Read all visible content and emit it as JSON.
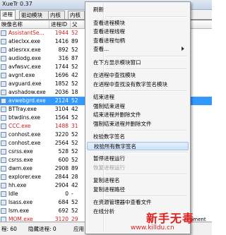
{
  "window": {
    "title": "XueTr 0.37"
  },
  "tabs": [
    {
      "label": "进程",
      "active": true
    },
    {
      "label": "驱动模块",
      "active": false
    },
    {
      "label": "内核",
      "active": false
    },
    {
      "label": "内核",
      "active": false
    }
  ],
  "columns": {
    "name": "映像名称",
    "pid": "进程ID",
    "ppid": "父"
  },
  "processes": [
    {
      "name": "AssistantSe...",
      "pid": "1944",
      "ppid": "52",
      "color": "red"
    },
    {
      "name": "atieclxx.exe",
      "pid": "1416",
      "ppid": "89",
      "color": "normal"
    },
    {
      "name": "atiesrxx.exe",
      "pid": "892",
      "ppid": "52",
      "color": "normal"
    },
    {
      "name": "audiodg.exe",
      "pid": "316",
      "ppid": "87",
      "color": "normal"
    },
    {
      "name": "avfwsvc.exe",
      "pid": "1744",
      "ppid": "52",
      "color": "normal"
    },
    {
      "name": "avgnt.exe",
      "pid": "1696",
      "ppid": "42",
      "color": "normal"
    },
    {
      "name": "avguard.exe",
      "pid": "1852",
      "ppid": "52",
      "color": "normal"
    },
    {
      "name": "avshadow.exe",
      "pid": "2036",
      "ppid": "18",
      "color": "normal"
    },
    {
      "name": "avwebgrd.exe",
      "pid": "2124",
      "ppid": "52",
      "color": "selected"
    },
    {
      "name": "BTTray.exe",
      "pid": "3104",
      "ppid": "42",
      "color": "normal"
    },
    {
      "name": "btwdins.exe",
      "pid": "1564",
      "ppid": "52",
      "color": "normal"
    },
    {
      "name": "CCC.exe",
      "pid": "1488",
      "ppid": "31",
      "color": "red"
    },
    {
      "name": "conhost.exe",
      "pid": "3220",
      "ppid": "52",
      "color": "normal"
    },
    {
      "name": "conhost.exe",
      "pid": "2564",
      "ppid": "52",
      "color": "normal"
    },
    {
      "name": "csrss.exe",
      "pid": "528",
      "ppid": "52",
      "color": "normal"
    },
    {
      "name": "csrss.exe",
      "pid": "600",
      "ppid": "52",
      "color": "normal"
    },
    {
      "name": "dwm.exe",
      "pid": "2908",
      "ppid": "89",
      "color": "normal"
    },
    {
      "name": "explorer.exe",
      "pid": "2844",
      "ppid": "28",
      "color": "normal"
    },
    {
      "name": "hh.exe",
      "pid": "2904",
      "ppid": "42",
      "color": "normal"
    },
    {
      "name": "Idle",
      "pid": "0",
      "ppid": "-",
      "color": "normal"
    },
    {
      "name": "lsass.exe",
      "pid": "684",
      "ppid": "52",
      "color": "normal"
    },
    {
      "name": "lsm.exe",
      "pid": "692",
      "ppid": "52",
      "color": "normal"
    },
    {
      "name": "MOM.exe",
      "pid": "3120",
      "ppid": "29",
      "color": "red"
    }
  ],
  "right_fragments": [
    "",
    "",
    "",
    "",
    "",
    "",
    "",
    "",
    "",
    "",
    "",
    "",
    "",
    "",
    "",
    "",
    "",
    "",
    "",
    "",
    "",
    "",
    "lement"
  ],
  "status": {
    "count": "程: 60",
    "hidden": "隐藏进程: 0",
    "tail": "应用"
  },
  "menu": {
    "items": [
      {
        "label": "刷新",
        "state": "normal",
        "submenu": false
      },
      {
        "sep": true
      },
      {
        "label": "查看进程模块",
        "state": "normal",
        "submenu": false
      },
      {
        "label": "查看进程线程",
        "state": "normal",
        "submenu": false
      },
      {
        "label": "查看进程句柄",
        "state": "normal",
        "submenu": false
      },
      {
        "label": "查看...",
        "state": "normal",
        "submenu": true
      },
      {
        "sep": true
      },
      {
        "label": "在下方显示模块窗口",
        "state": "normal",
        "submenu": false
      },
      {
        "sep": true
      },
      {
        "label": "在进程中查找模块",
        "state": "normal",
        "submenu": false
      },
      {
        "label": "在进程中查找没有数字签名模块",
        "state": "normal",
        "submenu": false
      },
      {
        "sep": true
      },
      {
        "label": "结束进程",
        "state": "normal",
        "submenu": false
      },
      {
        "label": "强制结束进程",
        "state": "normal",
        "submenu": false
      },
      {
        "label": "结束进程并删除文件",
        "state": "normal",
        "submenu": false
      },
      {
        "label": "强制结束进程并删除文件",
        "state": "normal",
        "submenu": false
      },
      {
        "sep": true
      },
      {
        "label": "校验数字签名",
        "state": "normal",
        "submenu": false
      },
      {
        "label": "校验所有数字签名",
        "state": "highlight",
        "submenu": false
      },
      {
        "sep": true
      },
      {
        "label": "暂停进程运行",
        "state": "normal",
        "submenu": false
      },
      {
        "label": "恢复进程运行",
        "state": "disabled",
        "submenu": false
      },
      {
        "sep": true
      },
      {
        "label": "复制进程名",
        "state": "normal",
        "submenu": false
      },
      {
        "label": "复制进程路径",
        "state": "normal",
        "submenu": false
      },
      {
        "sep": true
      },
      {
        "label": "在资源管理器中查看文件",
        "state": "normal",
        "submenu": false
      },
      {
        "label": "在线分析",
        "state": "normal",
        "submenu": false
      }
    ]
  },
  "watermark": {
    "main": "新手无毒",
    "sub": "www.killdu.cn"
  },
  "colors": {
    "selection": "#3399ff",
    "red_text": "#d32020",
    "watermark": "#e0201e"
  }
}
